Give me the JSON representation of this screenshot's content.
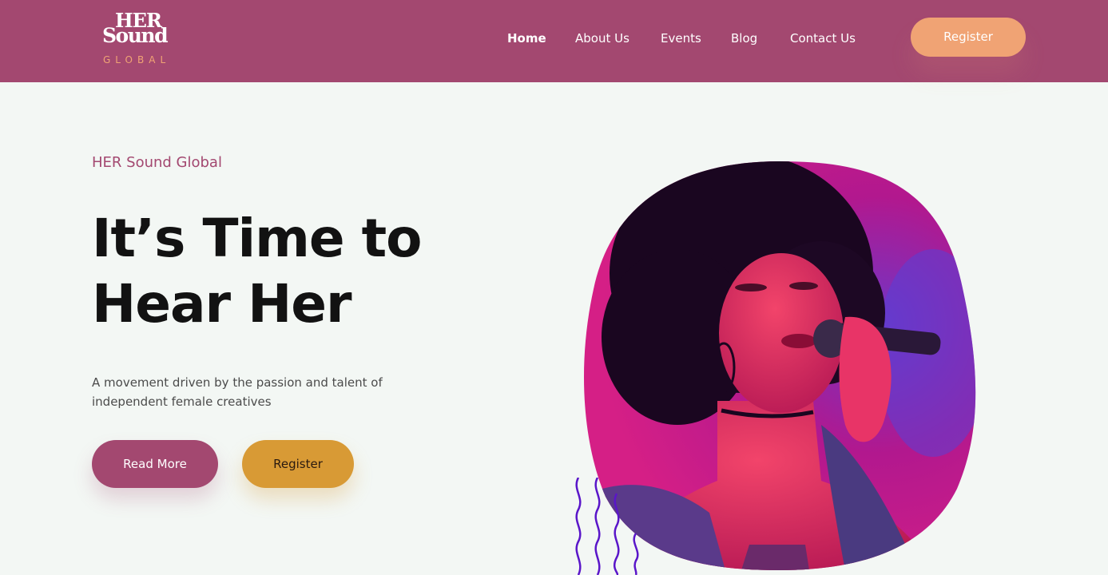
{
  "brand": {
    "logo_line1": "HER",
    "logo_line2": "Sound",
    "logo_line3": "GLOBAL"
  },
  "nav": {
    "items": [
      {
        "label": "Home",
        "active": true
      },
      {
        "label": "About Us",
        "active": false
      },
      {
        "label": "Events",
        "active": false
      },
      {
        "label": "Blog",
        "active": false
      },
      {
        "label": "Contact Us",
        "active": false
      }
    ],
    "register_label": "Register"
  },
  "hero": {
    "eyebrow": "HER Sound Global",
    "headline_line1": "It’s Time to",
    "headline_line2": "Hear Her",
    "subtext": "A movement driven by the passion and talent of independent female creatives",
    "read_more_label": "Read More",
    "register_label": "Register"
  },
  "colors": {
    "primary": "#a34870",
    "accent": "#f0a374",
    "gold": "#d89a35",
    "background": "#f3f7f4",
    "wave": "#5a16c9"
  },
  "icons": {
    "decoration": "wavy-lines-icon",
    "image": "singer-photo"
  }
}
